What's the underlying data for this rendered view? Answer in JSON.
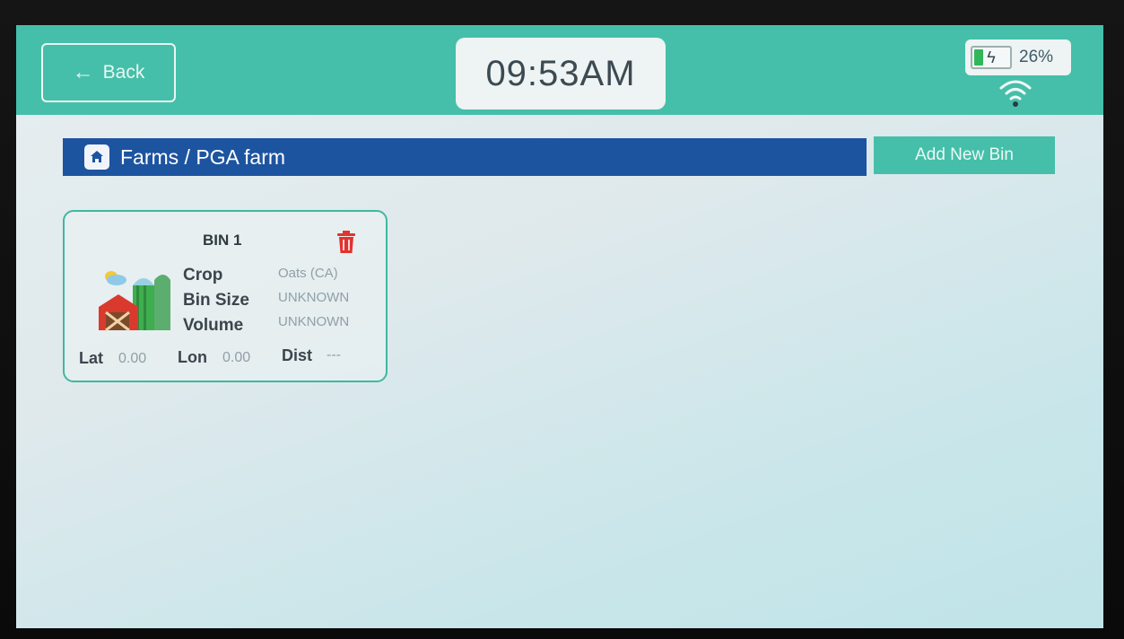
{
  "header": {
    "back_label": "Back",
    "clock": "09:53AM",
    "battery_percent": "26%",
    "battery_level": 0.26,
    "battery_color": "#2fb75a",
    "wifi_icon": "wifi-icon"
  },
  "breadcrumb": {
    "text": "Farms / PGA farm",
    "icon": "home-icon"
  },
  "actions": {
    "add_bin_label": "Add New Bin"
  },
  "bins": [
    {
      "title": "BIN 1",
      "crop_label": "Crop",
      "crop_value": "Oats (CA)",
      "size_label": "Bin Size",
      "size_value": "UNKNOWN",
      "volume_label": "Volume",
      "volume_value": "UNKNOWN",
      "lat_label": "Lat",
      "lat_value": "0.00",
      "lon_label": "Lon",
      "lon_value": "0.00",
      "dist_label": "Dist",
      "dist_value": "---"
    }
  ],
  "colors": {
    "accent": "#45bfa9",
    "breadcrumb_bg": "#1d54a0",
    "delete": "#e2332f"
  }
}
